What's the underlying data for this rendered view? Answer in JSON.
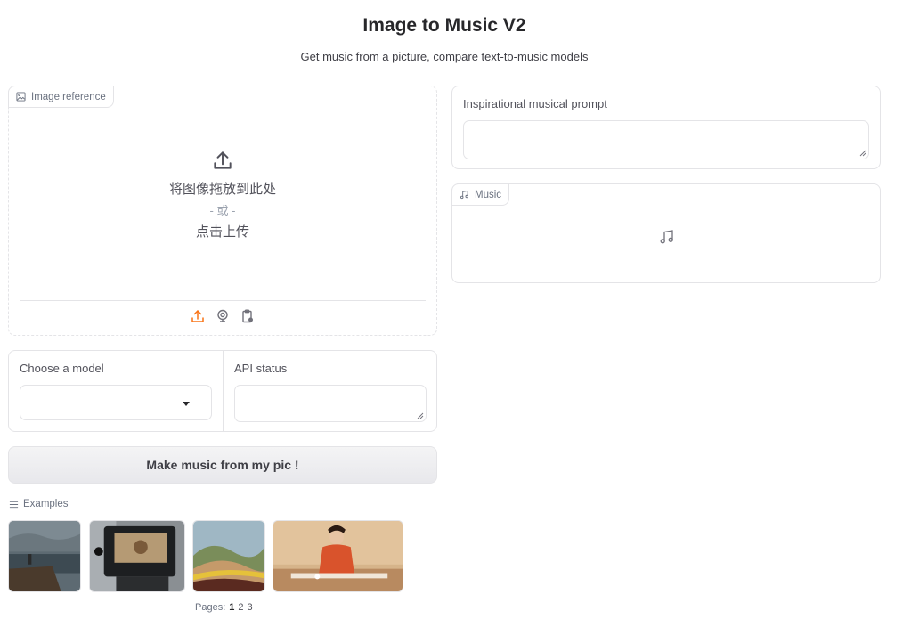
{
  "header": {
    "title": "Image to Music V2",
    "subtitle": "Get music from a picture, compare text-to-music models"
  },
  "image_input": {
    "label": "Image reference",
    "drop_text": "将图像拖放到此处",
    "or_text": "- 或 -",
    "click_text": "点击上传",
    "source_icons": [
      "upload-icon",
      "webcam-icon",
      "clipboard-icon"
    ],
    "active_source_color": "#f97316"
  },
  "model": {
    "label": "Choose a model",
    "selected": ""
  },
  "api_status": {
    "label": "API status",
    "value": ""
  },
  "submit": {
    "label": "Make music from my pic !"
  },
  "prompt": {
    "label": "Inspirational musical prompt",
    "value": ""
  },
  "music": {
    "label": "Music"
  },
  "examples": {
    "label": "Examples",
    "items": [
      "stormy-sea-example",
      "vintage-car-example",
      "rolling-hills-example",
      "diner-woman-example"
    ],
    "pages_label": "Pages:",
    "pages": [
      "1",
      "2",
      "3"
    ],
    "current_page": "1"
  }
}
